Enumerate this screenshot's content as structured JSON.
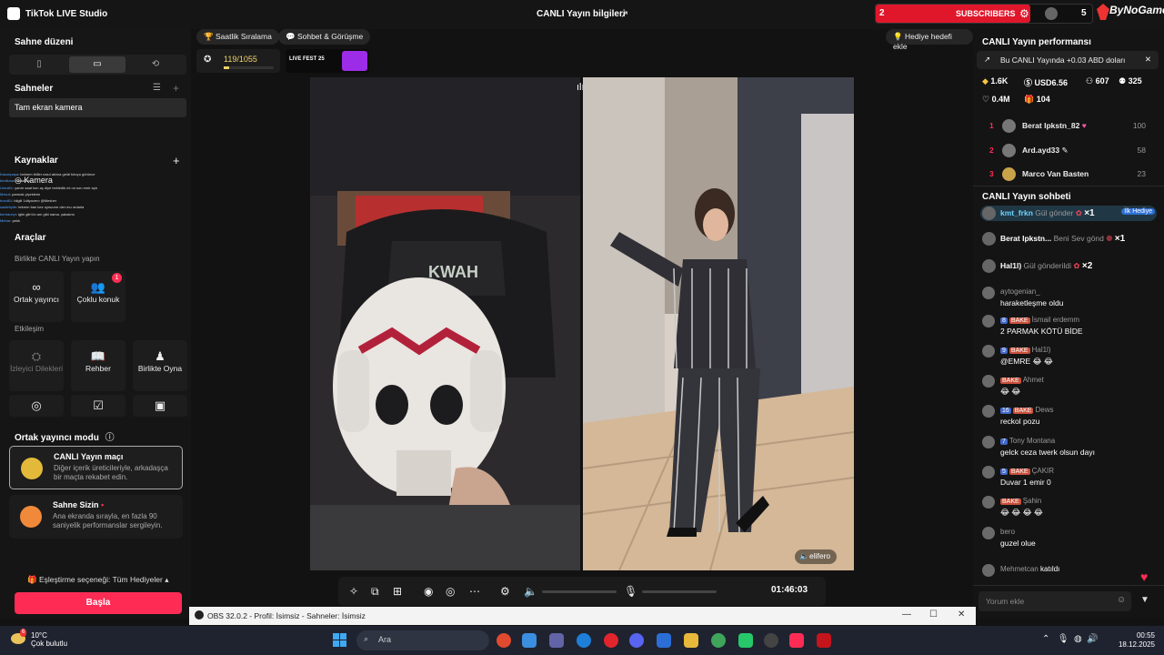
{
  "titlebar": {
    "app_name": "TikTok LIVE Studio",
    "center_title": "CANLI Yayın bilgileri"
  },
  "subscribers_widget": {
    "count": "2",
    "label": "SUBSCRIBERS",
    "right_number": "5"
  },
  "brand_badge": {
    "text": "ByNoGame"
  },
  "left_panel": {
    "scene_layout_title": "Sahne düzeni",
    "scenes_title": "Sahneler",
    "scene_item": "Tam ekran kamera",
    "sources_title": "Kaynaklar",
    "source_item": "Kamera",
    "chat_overlay_lines": [
      {
        "name": "Kasımpaşa",
        "text": ": bekrem ibiller nasıl aklına geldi fotoyu görünce"
      },
      {
        "name": "bediluna",
        "text": ": hahahah"
      },
      {
        "name": "Umut61",
        "text": ": yarım saat kon aç diye bekledik mi on son emir açtı"
      },
      {
        "name": "Mesut",
        "text": ": parmak çiçeklerin"
      },
      {
        "name": "bozd61",
        "text": ": bilgili 1dityocenı @Mesher"
      },
      {
        "name": "sadiebytle",
        "text": ": tekrem ban kez oynuorm oler mu ordarla"
      },
      {
        "name": "berhaneyt",
        "text": ": iglin glin'ün am gibi nama. yakalımı"
      },
      {
        "name": "Mehar",
        "text": ": pekk"
      }
    ],
    "tools_title": "Araçlar",
    "collab_title": "Birlikte CANLI Yayın yapın",
    "tools_collab": [
      {
        "label": "Ortak yayıncı",
        "icon": "link-icon"
      },
      {
        "label": "Çoklu konuk",
        "icon": "multi-guest-icon",
        "badge": "1"
      }
    ],
    "interaction_title": "Etkileşim",
    "tools_interaction": [
      {
        "label": "İzleyici Dilekleri",
        "icon": "wishes-icon",
        "disabled": true
      },
      {
        "label": "Rehber",
        "icon": "guide-icon"
      },
      {
        "label": "Birlikte Oyna",
        "icon": "play-together-icon"
      }
    ],
    "cohost_mode_title": "Ortak yayıncı modu",
    "mode_cards": [
      {
        "title": "CANLI Yayın maçı",
        "desc": "Diğer içerik üreticileriyle, arkadaşça bir maçta rekabet edin."
      },
      {
        "title": "Sahne Sizin",
        "desc": "Ana ekranda sırayla, en fazla 90 saniyelik performanslar sergileyin."
      }
    ],
    "match_option": "Eşleştirme seçeneği: Tüm Hediyeler",
    "start_button": "Başla"
  },
  "center": {
    "pill_1": "Saatlik Sıralama",
    "pill_2": "Sohbet & Görüşme",
    "gift_goal": "Hediye hedefi ekle",
    "stat_progress": "119/1055",
    "live_fest": "LIVE FEST 25",
    "cohost_name": "elifero",
    "timer": "01:46:03"
  },
  "right_panel": {
    "perf_title": "CANLI Yayın performansı",
    "info_line": "Bu CANLI Yayında +0.03 ABD doları",
    "stats": [
      {
        "icon": "diamond-icon",
        "value": "1.6K"
      },
      {
        "icon": "dollar-icon",
        "value": "USD6.56"
      },
      {
        "icon": "viewers-icon",
        "value": "607"
      },
      {
        "icon": "followers-icon",
        "value": "325"
      },
      {
        "icon": "heart-icon",
        "value": "0.4M"
      },
      {
        "icon": "gift-icon",
        "value": "104"
      }
    ],
    "ranking": [
      {
        "rank": "1",
        "name": "Berat Ipkstn_82",
        "value": "100"
      },
      {
        "rank": "2",
        "name": "Ard.ayd33",
        "value": "58"
      },
      {
        "rank": "3",
        "name": "Marco Van Basten",
        "value": "23"
      }
    ],
    "chat_title": "CANLI Yayın sohbeti",
    "gift_events": [
      {
        "name": "kmt_frkn",
        "text": "Gül gönder",
        "mult": "×1",
        "tag": "İlk Hediye"
      },
      {
        "name": "Berat Ipkstn...",
        "text": "Beni Sev gönd",
        "mult": "×1"
      },
      {
        "name": "Hal1l)",
        "text": "Gül gönderildi",
        "mult": "×2"
      }
    ],
    "comments": [
      {
        "user": "aytogenian_",
        "level": "",
        "fan": "",
        "text": "haraketleşme oldu"
      },
      {
        "user": "İsmail erdemm",
        "level": "8",
        "fan": "BAKE",
        "text": "2 PARMAK KÖTÜ BİDE"
      },
      {
        "user": "Hal1l)",
        "level": "9",
        "fan": "BAKE",
        "text": "@EMRE 😂 😂"
      },
      {
        "user": "Ahmet",
        "level": "",
        "fan": "BAKE",
        "text": "😂 😂"
      },
      {
        "user": "Dews",
        "level": "16",
        "fan": "BAKE",
        "text": "reckol pozu"
      },
      {
        "user": "Tony Montana",
        "level": "7",
        "fan": "",
        "text": "gelck ceza twerk olsun dayı"
      },
      {
        "user": "ÇAKIR",
        "level": "5",
        "fan": "BAKE",
        "text": "Duvar 1 emir 0"
      },
      {
        "user": "Şahin",
        "level": "",
        "fan": "BAKE",
        "text": "😂 😂 😂 😂"
      },
      {
        "user": "bero",
        "level": "",
        "fan": "",
        "text": "guzel olue"
      }
    ],
    "join_event": {
      "user": "Mehmetcan",
      "text": "katıldı"
    },
    "comment_placeholder": "Yorum ekle"
  },
  "obs_bar": {
    "title": "OBS 32.0.2 - Profil: İsimsiz - Sahneler: İsimsiz"
  },
  "taskbar": {
    "weather_temp": "10°C",
    "weather_desc": "Çok bulutlu",
    "weather_badge": "6",
    "search_placeholder": "Ara",
    "time": "00:55",
    "date": "18.12.2025"
  }
}
